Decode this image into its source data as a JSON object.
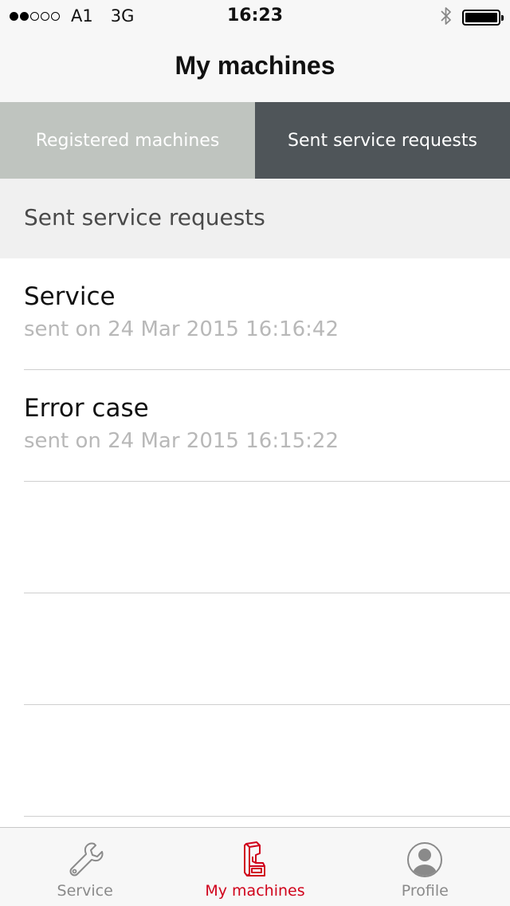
{
  "status_bar": {
    "carrier": "A1",
    "network": "3G",
    "time": "16:23",
    "signal_bars_filled": 2,
    "signal_bars_total": 5,
    "battery_level": 1.0
  },
  "nav": {
    "title": "My machines"
  },
  "segments": [
    {
      "label": "Registered machines",
      "selected": false
    },
    {
      "label": "Sent service requests",
      "selected": true
    }
  ],
  "section": {
    "title": "Sent service requests"
  },
  "requests": [
    {
      "title": "Service",
      "sent": "sent on 24 Mar 2015 16:16:42"
    },
    {
      "title": "Error case",
      "sent": "sent on 24 Mar 2015 16:15:22"
    },
    {
      "title": "",
      "sent": ""
    },
    {
      "title": "",
      "sent": ""
    },
    {
      "title": "",
      "sent": ""
    }
  ],
  "tab_bar": {
    "items": [
      {
        "label": "Service",
        "icon": "wrench-icon",
        "active": false
      },
      {
        "label": "My machines",
        "icon": "machine-icon",
        "active": true
      },
      {
        "label": "Profile",
        "icon": "profile-icon",
        "active": false
      }
    ]
  },
  "colors": {
    "accent": "#d0021b",
    "segment_inactive": "#bfc4bf",
    "segment_active": "#4f5559",
    "subtitle_gray": "#b8b8b8"
  }
}
